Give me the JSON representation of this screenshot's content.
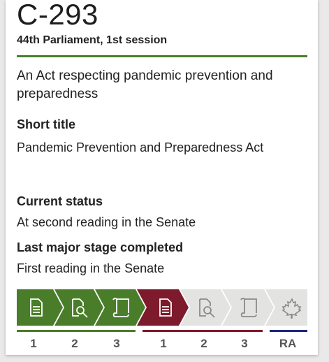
{
  "bill": {
    "number": "C-293",
    "session": "44th Parliament, 1st session",
    "long_title": "An Act respecting pandemic prevention and preparedness",
    "short_title_label": "Short title",
    "short_title": "Pandemic Prevention and Preparedness Act",
    "current_status_label": "Current status",
    "current_status": "At second reading in the Senate",
    "last_stage_label": "Last major stage completed",
    "last_stage": "First reading in the Senate"
  },
  "colors": {
    "house": "#4a7d2a",
    "senate": "#7d1a2b",
    "pending": "#e3e3e1",
    "royal_assent": "#1b2580"
  },
  "stages": [
    {
      "label": "1",
      "chamber": "house",
      "icon": "document-icon",
      "status": "complete"
    },
    {
      "label": "2",
      "chamber": "house",
      "icon": "review-magnifier-icon",
      "status": "complete"
    },
    {
      "label": "3",
      "chamber": "house",
      "icon": "scroll-icon",
      "status": "complete"
    },
    {
      "label": "1",
      "chamber": "senate",
      "icon": "document-icon",
      "status": "complete"
    },
    {
      "label": "2",
      "chamber": "senate",
      "icon": "review-magnifier-icon",
      "status": "pending"
    },
    {
      "label": "3",
      "chamber": "senate",
      "icon": "scroll-icon",
      "status": "pending"
    },
    {
      "label": "RA",
      "chamber": "royal_assent",
      "icon": "maple-leaf-icon",
      "status": "pending"
    }
  ]
}
